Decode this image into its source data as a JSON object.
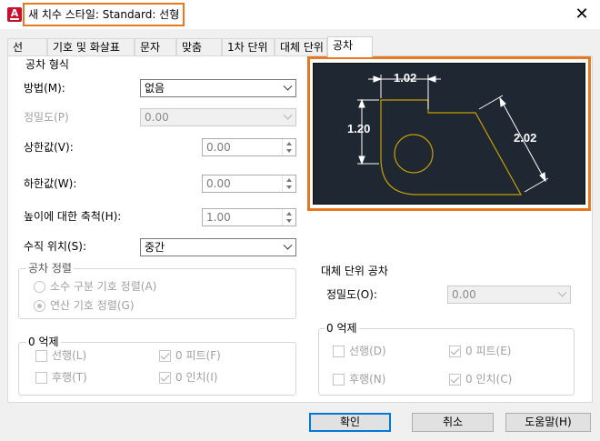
{
  "window": {
    "title": "새 치수 스타일: Standard: 선형",
    "app_icon_letter": "A",
    "close_glyph": "✕"
  },
  "tabs": [
    {
      "label": "선"
    },
    {
      "label": "기호 및 화살표"
    },
    {
      "label": "문자"
    },
    {
      "label": "맞춤"
    },
    {
      "label": "1차 단위"
    },
    {
      "label": "대체 단위"
    },
    {
      "label": "공차",
      "active": true
    }
  ],
  "tolerance_format": {
    "legend": "공차 형식",
    "method": {
      "label": "방법(M):",
      "value": "없음"
    },
    "precision": {
      "label": "정밀도(P)",
      "value": "0.00"
    },
    "upper_value": {
      "label": "상한값(V):",
      "value": "0.00"
    },
    "lower_value": {
      "label": "하한값(W):",
      "value": "0.00"
    },
    "height_scale": {
      "label": "높이에 대한 축척(H):",
      "value": "1.00"
    },
    "vertical_position": {
      "label": "수직 위치(S):",
      "value": "중간"
    }
  },
  "tolerance_alignment": {
    "legend": "공차 정렬",
    "align_decimal": {
      "label": "소수 구분 기호 정렬(A)",
      "checked": false
    },
    "align_operator": {
      "label": "연산 기호 정렬(G)",
      "checked": true
    }
  },
  "zero_suppression": {
    "legend": "0 억제",
    "leading": {
      "label": "선행(L)",
      "checked": false
    },
    "zero_feet": {
      "label": "0 피트(F)",
      "checked": true
    },
    "trailing": {
      "label": "후행(T)",
      "checked": false
    },
    "zero_inches": {
      "label": "0 인치(I)",
      "checked": true
    }
  },
  "alt_unit_tolerance": {
    "legend": "대체 단위 공차",
    "precision": {
      "label": "정밀도(O):",
      "value": "0.00"
    }
  },
  "alt_zero_suppression": {
    "legend": "0 억제",
    "leading": {
      "label": "선행(D)",
      "checked": false
    },
    "zero_feet": {
      "label": "0 피트(E)",
      "checked": true
    },
    "trailing": {
      "label": "후행(N)",
      "checked": false
    },
    "zero_inches": {
      "label": "0 인치(C)",
      "checked": true
    }
  },
  "preview": {
    "dim_top": "1.02",
    "dim_left": "1.20",
    "dim_diag": "2.02",
    "colors": {
      "background": "#1f2733",
      "shape": "#c8a000",
      "dimension": "#ffffff"
    }
  },
  "buttons": {
    "ok": "확인",
    "cancel": "취소",
    "help": "도움말(H)"
  },
  "colors": {
    "highlight": "#e87722",
    "accent": "#0078d7"
  }
}
